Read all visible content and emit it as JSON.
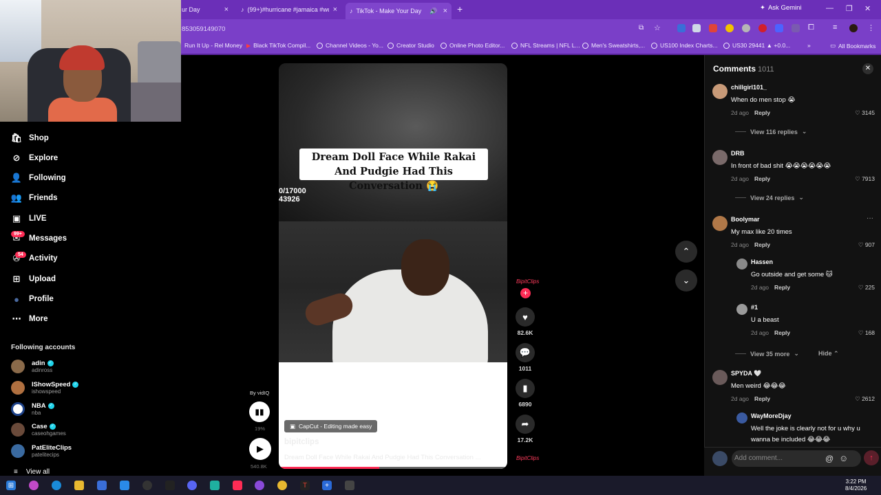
{
  "browser": {
    "tabs": [
      {
        "label": "ur Day",
        "close": "×"
      },
      {
        "label": "(99+)#hurricane #jamaica #we",
        "close": "×"
      },
      {
        "label": "TikTok - Make Your Day",
        "close": "×"
      }
    ],
    "ask_gemini": "Ask Gemini",
    "url": "8530591490​70",
    "bookmarks": [
      "Run It Up - Rel Money",
      "Black TikTok Compil...",
      "Channel Videos - Yo...",
      "Creator Studio",
      "Online Photo Editor...",
      "NFL Streams | NFL L...",
      "Men's Sweatshirts,...",
      "US100 Index Charts...",
      "US30 29441 ▲ +0.0...",
      "All Bookmarks"
    ]
  },
  "nav": {
    "items": [
      {
        "label": "Shop",
        "icon": "shop-icon",
        "glyph": "🛍"
      },
      {
        "label": "Explore",
        "icon": "compass-icon",
        "glyph": "⊘"
      },
      {
        "label": "Following",
        "icon": "person-icon",
        "glyph": "👤"
      },
      {
        "label": "Friends",
        "icon": "friends-icon",
        "glyph": "👥"
      },
      {
        "label": "LIVE",
        "icon": "live-icon",
        "glyph": "▣"
      },
      {
        "label": "Messages",
        "icon": "messages-icon",
        "glyph": "✉"
      },
      {
        "label": "Activity",
        "icon": "activity-icon",
        "glyph": "✇"
      },
      {
        "label": "Upload",
        "icon": "upload-icon",
        "glyph": "⊞"
      },
      {
        "label": "Profile",
        "icon": "profile-icon",
        "glyph": "●"
      },
      {
        "label": "More",
        "icon": "more-icon",
        "glyph": "⋯"
      }
    ],
    "badges": {
      "messages": "99+",
      "activity": "54"
    },
    "following_title": "Following accounts",
    "accounts": [
      {
        "name": "adin",
        "handle": "adinross",
        "color": "#8a6a4a"
      },
      {
        "name": "IShowSpeed",
        "handle": "ishowspeed",
        "color": "#b07040"
      },
      {
        "name": "NBA",
        "handle": "nba",
        "color": "#1d428a"
      },
      {
        "name": "Case",
        "handle": "caseohgames",
        "color": "#6a4a3a"
      },
      {
        "name": "PatEliteClips",
        "handle": "patelitecips",
        "color": "#3a6aa0"
      }
    ],
    "view_all": "View all"
  },
  "video": {
    "caption": "Dream Doll Face While Rakai And Pudgie Had This Conversation 😭",
    "counter_line1": "0/17000",
    "counter_line2": "43926",
    "capcut": "CapCut - Editing made easy",
    "author": "bipitclips",
    "description": "Dream Doll Face While Rakai And Pudgie Had This Conversation ...",
    "more": "more",
    "progress": 0.44,
    "watermark": "BipitClips"
  },
  "actions": {
    "likes": "82.6K",
    "comments": "1011",
    "saves": "6890",
    "shares": "17.2K"
  },
  "vidiq": {
    "by": "By vidIQ",
    "percent": "19%",
    "views": "540.8K"
  },
  "comments": {
    "title": "Comments",
    "count": "1011",
    "items": [
      {
        "user": "chillgirl101_",
        "text": "When do men stop 😭",
        "time": "2d ago",
        "reply": "Reply",
        "likes": "3145",
        "color": "#c89a78"
      },
      {
        "user": "DRB",
        "text": "In front of bad shit 😭😭😭😭😭😭",
        "time": "2d ago",
        "reply": "Reply",
        "likes": "7913",
        "color": "#7a6a6a"
      },
      {
        "user": "Boolymar",
        "text": "My max like 20 times",
        "time": "2d ago",
        "reply": "Reply",
        "likes": "907",
        "color": "#b07848"
      },
      {
        "user": "Hassen",
        "text": "Go outside and get some 🐱",
        "time": "2d ago",
        "reply": "Reply",
        "likes": "225",
        "color": "#8a8a8a"
      },
      {
        "user": "#1",
        "text": "U a beast",
        "time": "2d ago",
        "reply": "Reply",
        "likes": "168",
        "color": "#9a9a9a"
      },
      {
        "user": "SPYDA 🤍",
        "text": "Men weird 😂😂😂",
        "time": "2d ago",
        "reply": "Reply",
        "likes": "2612",
        "color": "#6a5a5a"
      },
      {
        "user": "WayMoreDjay",
        "text": "Well the joke is clearly not for u why u",
        "time": "",
        "reply": "",
        "likes": "",
        "color": "#3a5aa0"
      }
    ],
    "view_replies": [
      "View 116 replies",
      "View 24 replies",
      "View 35 more"
    ],
    "hide": "Hide",
    "add_placeholder": "Add comment...",
    "partial_line": "wanna be included 😂😂😂"
  },
  "taskbar": {
    "time": "3:22 PM",
    "date": "8/4/2026"
  }
}
